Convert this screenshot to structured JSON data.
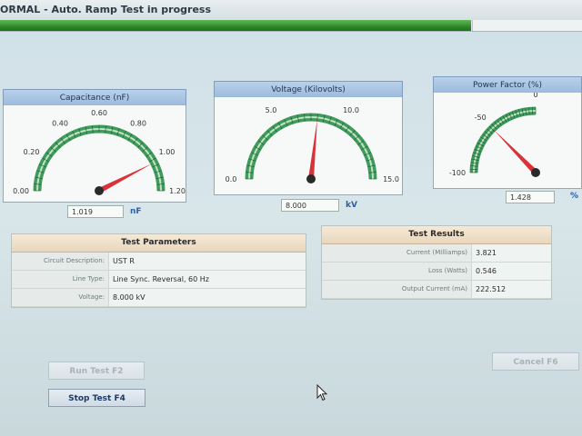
{
  "window": {
    "title": "ORMAL - Auto. Ramp Test in progress",
    "progress_fraction": 0.81
  },
  "gauges": {
    "capacitance": {
      "title": "Capacitance (nF)",
      "ticks": [
        "0.00",
        "0.20",
        "0.40",
        "0.60",
        "0.80",
        "1.00",
        "1.20"
      ],
      "min": 0,
      "max": 1.2,
      "value": 1.019,
      "readout": "1.019",
      "unit": "nF"
    },
    "voltage": {
      "title": "Voltage (Kilovolts)",
      "ticks": [
        "0.0",
        "5.0",
        "10.0",
        "15.0"
      ],
      "min": 0,
      "max": 15,
      "value": 8.0,
      "readout": "8.000",
      "unit": "kV"
    },
    "power_factor": {
      "title": "Power Factor (%)",
      "ticks": [
        "-100",
        "-50",
        "0"
      ],
      "min": -100,
      "max": 100,
      "value": 1.428,
      "readout": "1.428",
      "unit": "%"
    }
  },
  "parameters": {
    "title": "Test Parameters",
    "rows": [
      {
        "label": "Circuit Description:",
        "value": "UST R"
      },
      {
        "label": "Line Type:",
        "value": "Line Sync. Reversal, 60 Hz"
      },
      {
        "label": "Voltage:",
        "value": "8.000 kV"
      }
    ]
  },
  "results": {
    "title": "Test Results",
    "rows": [
      {
        "label": "Current (Milliamps)",
        "value": "3.821"
      },
      {
        "label": "Loss (Watts)",
        "value": "0.546"
      },
      {
        "label": "Output Current (mA)",
        "value": "222.512"
      }
    ]
  },
  "buttons": {
    "run_test": "Run Test   F2",
    "stop_test": "Stop Test   F4",
    "cancel": "Cancel   F6"
  },
  "colors": {
    "needle": "#d8323a",
    "arc": "#3f9a5c",
    "progress": "#2f8a2a",
    "header": "#9ab9db"
  }
}
